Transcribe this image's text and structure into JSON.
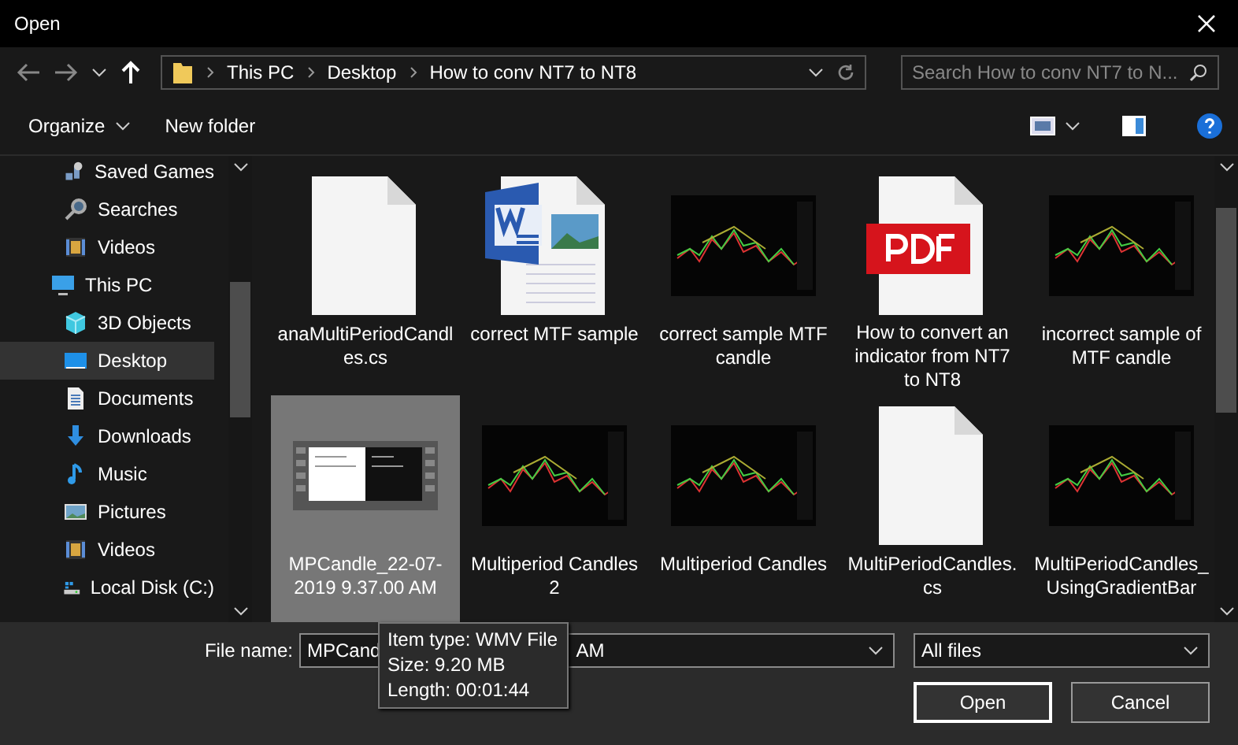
{
  "window": {
    "title": "Open"
  },
  "address": {
    "crumbs": [
      "This PC",
      "Desktop",
      "How to conv NT7 to NT8"
    ]
  },
  "search": {
    "placeholder": "Search How to conv NT7 to N..."
  },
  "toolbar": {
    "organize": "Organize",
    "new_folder": "New folder"
  },
  "sidebar": {
    "items": [
      {
        "children": [
          {
            "label": "Saved Games",
            "kind": "games",
            "selected": false
          },
          {
            "label": "Searches",
            "kind": "search",
            "selected": false
          },
          {
            "label": "Videos",
            "kind": "videos",
            "selected": false
          }
        ]
      },
      {
        "label": "This PC",
        "kind": "pc",
        "selected": false,
        "children": [
          {
            "label": "3D Objects",
            "kind": "objects",
            "selected": false
          },
          {
            "label": "Desktop",
            "kind": "desktop",
            "selected": true
          },
          {
            "label": "Documents",
            "kind": "documents",
            "selected": false
          },
          {
            "label": "Downloads",
            "kind": "downloads",
            "selected": false
          },
          {
            "label": "Music",
            "kind": "music",
            "selected": false
          },
          {
            "label": "Pictures",
            "kind": "pictures",
            "selected": false
          },
          {
            "label": "Videos",
            "kind": "videos",
            "selected": false
          },
          {
            "label": "Local Disk (C:)",
            "kind": "disk",
            "selected": false
          }
        ]
      }
    ]
  },
  "files": [
    {
      "name": "anaMultiPeriodCandles.cs",
      "kind": "blank",
      "selected": false
    },
    {
      "name": "correct MTF sample",
      "kind": "word",
      "selected": false
    },
    {
      "name": "correct sample MTF candle",
      "kind": "chart",
      "selected": false
    },
    {
      "name": "How to convert an indicator from NT7 to NT8",
      "kind": "pdf",
      "selected": false
    },
    {
      "name": "incorrect  sample of MTF candle",
      "kind": "chart",
      "selected": false
    },
    {
      "name": "MPCandle_22-07-2019 9.37.00 AM",
      "kind": "video",
      "selected": true
    },
    {
      "name": "Multiperiod Candles 2",
      "kind": "chart",
      "selected": false
    },
    {
      "name": "Multiperiod Candles",
      "kind": "chart",
      "selected": false
    },
    {
      "name": "MultiPeriodCandles.cs",
      "kind": "blank",
      "selected": false
    },
    {
      "name": "MultiPeriodCandles_UsingGradientBar",
      "kind": "chart",
      "selected": false
    }
  ],
  "file_name": {
    "label": "File name:",
    "value_start": "MPCand",
    "value_end": "AM"
  },
  "file_type": {
    "value": "All files"
  },
  "buttons": {
    "open": "Open",
    "cancel": "Cancel"
  },
  "tooltip": {
    "lines": [
      "Item type: WMV File",
      "Size: 9.20 MB",
      "Length: 00:01:44"
    ]
  }
}
